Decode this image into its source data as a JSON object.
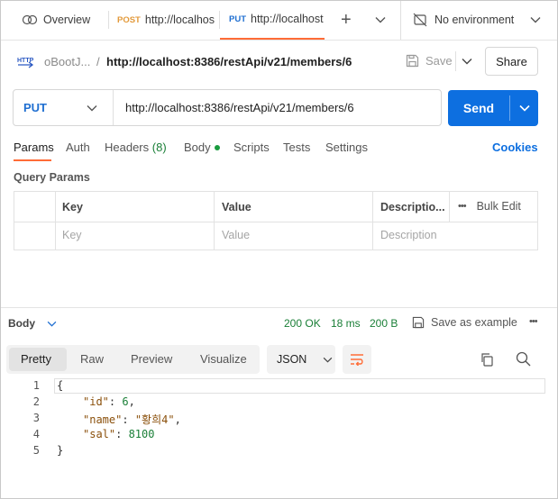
{
  "tabs": {
    "overview": "Overview",
    "post_method": "POST",
    "post_url": "http://localhos",
    "put_method": "PUT",
    "put_url": "http://localhost",
    "add": "+",
    "environment": "No environment"
  },
  "breadcrumb": {
    "collection": "oBootJ...",
    "separator": "/",
    "request": "http://localhost:8386/restApi/v21/members/6",
    "save_label": "Save",
    "share_label": "Share"
  },
  "request": {
    "method": "PUT",
    "url": "http://localhost:8386/restApi/v21/members/6",
    "send_label": "Send"
  },
  "request_tabs": {
    "params": "Params",
    "auth": "Auth",
    "headers": "Headers",
    "headers_count": "(8)",
    "body": "Body",
    "scripts": "Scripts",
    "tests": "Tests",
    "settings": "Settings",
    "cookies": "Cookies"
  },
  "query_params": {
    "title": "Query Params",
    "headers": [
      "Key",
      "Value",
      "Descriptio..."
    ],
    "bulk_edit": "Bulk Edit",
    "placeholders": [
      "Key",
      "Value",
      "Description"
    ]
  },
  "response": {
    "body_label": "Body",
    "status": "200 OK",
    "time": "18 ms",
    "size": "200 B",
    "save_example": "Save as example",
    "view_tabs": [
      "Pretty",
      "Raw",
      "Preview",
      "Visualize"
    ],
    "format": "JSON",
    "lines": [
      {
        "n": "1",
        "text": "{"
      },
      {
        "n": "2",
        "key": "\"id\"",
        "value": "6",
        "comma": ","
      },
      {
        "n": "3",
        "key": "\"name\"",
        "value": "\"황희4\"",
        "comma": ","
      },
      {
        "n": "4",
        "key": "\"sal\"",
        "value": "8100",
        "comma": ""
      },
      {
        "n": "5",
        "text": "}"
      }
    ]
  },
  "colors": {
    "accent_orange": "#ff6c37",
    "send_blue": "#0d6fe0",
    "status_green": "#1a7f37",
    "link_blue": "#0d6fe0"
  }
}
